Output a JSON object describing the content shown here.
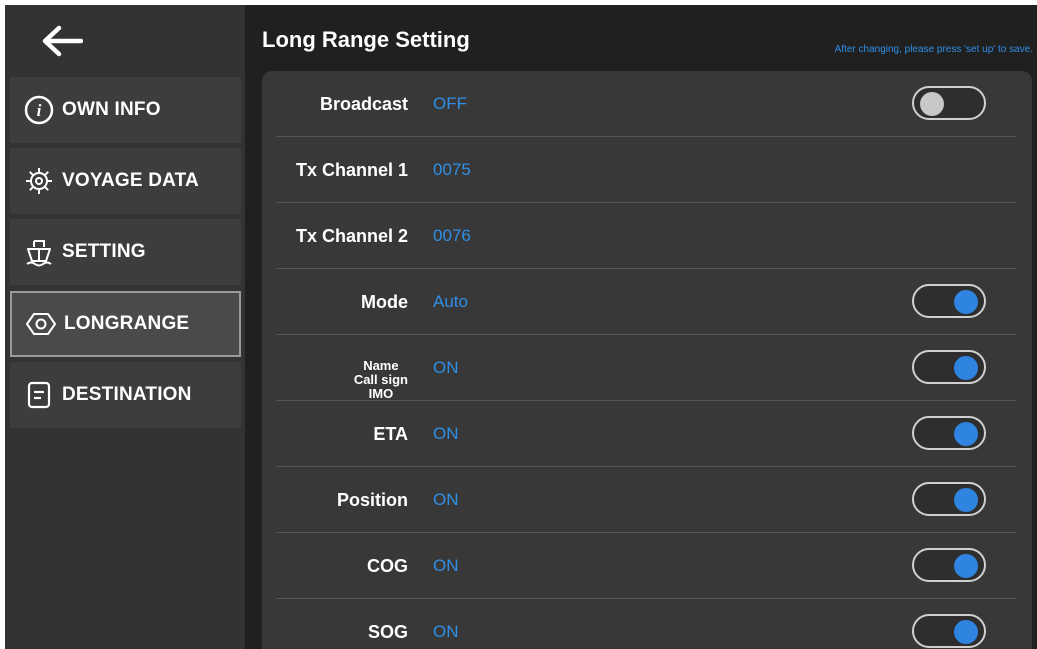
{
  "sidebar": {
    "items": [
      {
        "label": "OWN INFO"
      },
      {
        "label": "VOYAGE DATA"
      },
      {
        "label": "SETTING"
      },
      {
        "label": "LONGRANGE"
      },
      {
        "label": "DESTINATION"
      }
    ]
  },
  "header": {
    "title": "Long Range Setting",
    "hint": "After changing, please press 'set up' to save."
  },
  "rows": [
    {
      "label": "Broadcast",
      "value": "OFF",
      "toggle": "off"
    },
    {
      "label": "Tx Channel 1",
      "value": "0075"
    },
    {
      "label": "Tx Channel 2",
      "value": "0076"
    },
    {
      "label": "Mode",
      "value": "Auto",
      "toggle": "on"
    },
    {
      "label_lines": [
        "Name",
        "Call sign",
        "IMO"
      ],
      "value": "ON",
      "toggle": "on"
    },
    {
      "label": "ETA",
      "value": "ON",
      "toggle": "on"
    },
    {
      "label": "Position",
      "value": "ON",
      "toggle": "on"
    },
    {
      "label": "COG",
      "value": "ON",
      "toggle": "on"
    },
    {
      "label": "SOG",
      "value": "ON",
      "toggle": "on"
    }
  ],
  "colors": {
    "accent": "#2f84e0",
    "value_text": "#2f8fe6",
    "background": "#202020"
  },
  "icons": [
    "back-arrow-icon",
    "info-icon",
    "ship-wheel-icon",
    "ship-icon",
    "longrange-icon",
    "destination-icon"
  ]
}
